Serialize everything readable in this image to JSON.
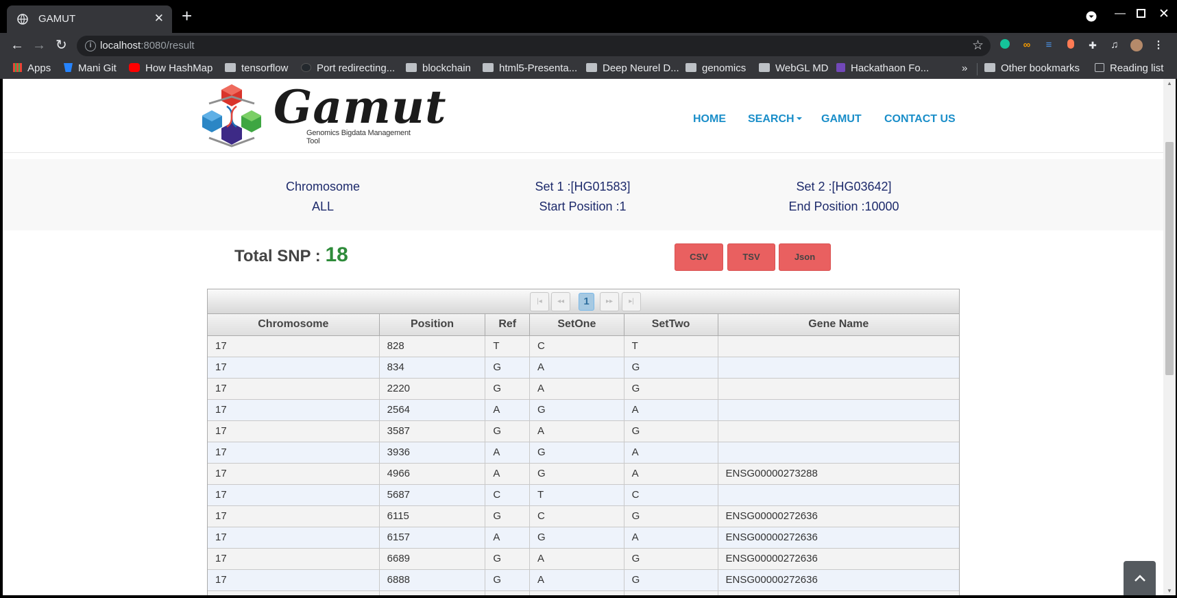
{
  "browser": {
    "tab_title": "GAMUT",
    "new_tab": "+",
    "url_host": "localhost",
    "url_path": ":8080/result",
    "bookmarks": [
      {
        "label": "Apps",
        "kind": "apps"
      },
      {
        "label": "Mani Git",
        "kind": "bitbucket"
      },
      {
        "label": "How HashMap",
        "kind": "youtube"
      },
      {
        "label": "tensorflow",
        "kind": "folder"
      },
      {
        "label": "Port redirecting...",
        "kind": "github"
      },
      {
        "label": "blockchain",
        "kind": "folder"
      },
      {
        "label": "html5-Presenta...",
        "kind": "folder"
      },
      {
        "label": "Deep Neurel D...",
        "kind": "folder"
      },
      {
        "label": "genomics",
        "kind": "folder"
      },
      {
        "label": "WebGL MD",
        "kind": "folder"
      },
      {
        "label": "Hackathaon Fo...",
        "kind": "form"
      }
    ],
    "more_bookmarks": "»",
    "other_bookmarks": "Other bookmarks",
    "reading_list": "Reading list"
  },
  "site": {
    "logo_text": "Gamut",
    "logo_tagline": "Genomics Bigdata Management Tool",
    "nav": [
      "HOME",
      "SEARCH",
      "GAMUT",
      "CONTACT US"
    ]
  },
  "summary": {
    "chromosome_label": "Chromosome",
    "chromosome_value": "ALL",
    "set1": "Set 1 :[HG01583]",
    "start_position": "Start Position :1",
    "set2": "Set 2 :[HG03642]",
    "end_position": "End Position :10000"
  },
  "total_snp": {
    "label": "Total SNP :",
    "value": "18"
  },
  "downloads": [
    "CSV",
    "TSV",
    "Json"
  ],
  "pager": {
    "current_page": "1"
  },
  "table": {
    "columns": [
      "Chromosome",
      "Position",
      "Ref",
      "SetOne",
      "SetTwo",
      "Gene Name"
    ],
    "rows": [
      [
        "17",
        "828",
        "T",
        "C",
        "T",
        ""
      ],
      [
        "17",
        "834",
        "G",
        "A",
        "G",
        ""
      ],
      [
        "17",
        "2220",
        "G",
        "A",
        "G",
        ""
      ],
      [
        "17",
        "2564",
        "A",
        "G",
        "A",
        ""
      ],
      [
        "17",
        "3587",
        "G",
        "A",
        "G",
        ""
      ],
      [
        "17",
        "3936",
        "A",
        "G",
        "A",
        ""
      ],
      [
        "17",
        "4966",
        "A",
        "G",
        "A",
        "ENSG00000273288"
      ],
      [
        "17",
        "5687",
        "C",
        "T",
        "C",
        ""
      ],
      [
        "17",
        "6115",
        "G",
        "C",
        "G",
        "ENSG00000272636"
      ],
      [
        "17",
        "6157",
        "A",
        "G",
        "A",
        "ENSG00000272636"
      ],
      [
        "17",
        "6689",
        "G",
        "A",
        "G",
        "ENSG00000272636"
      ],
      [
        "17",
        "6888",
        "G",
        "A",
        "G",
        "ENSG00000272636"
      ]
    ]
  },
  "colors": {
    "nav_link": "#1a8ec9",
    "summary_text": "#1d2a6b",
    "snp_count": "#2e8b3a",
    "download_button": "#e96060"
  }
}
